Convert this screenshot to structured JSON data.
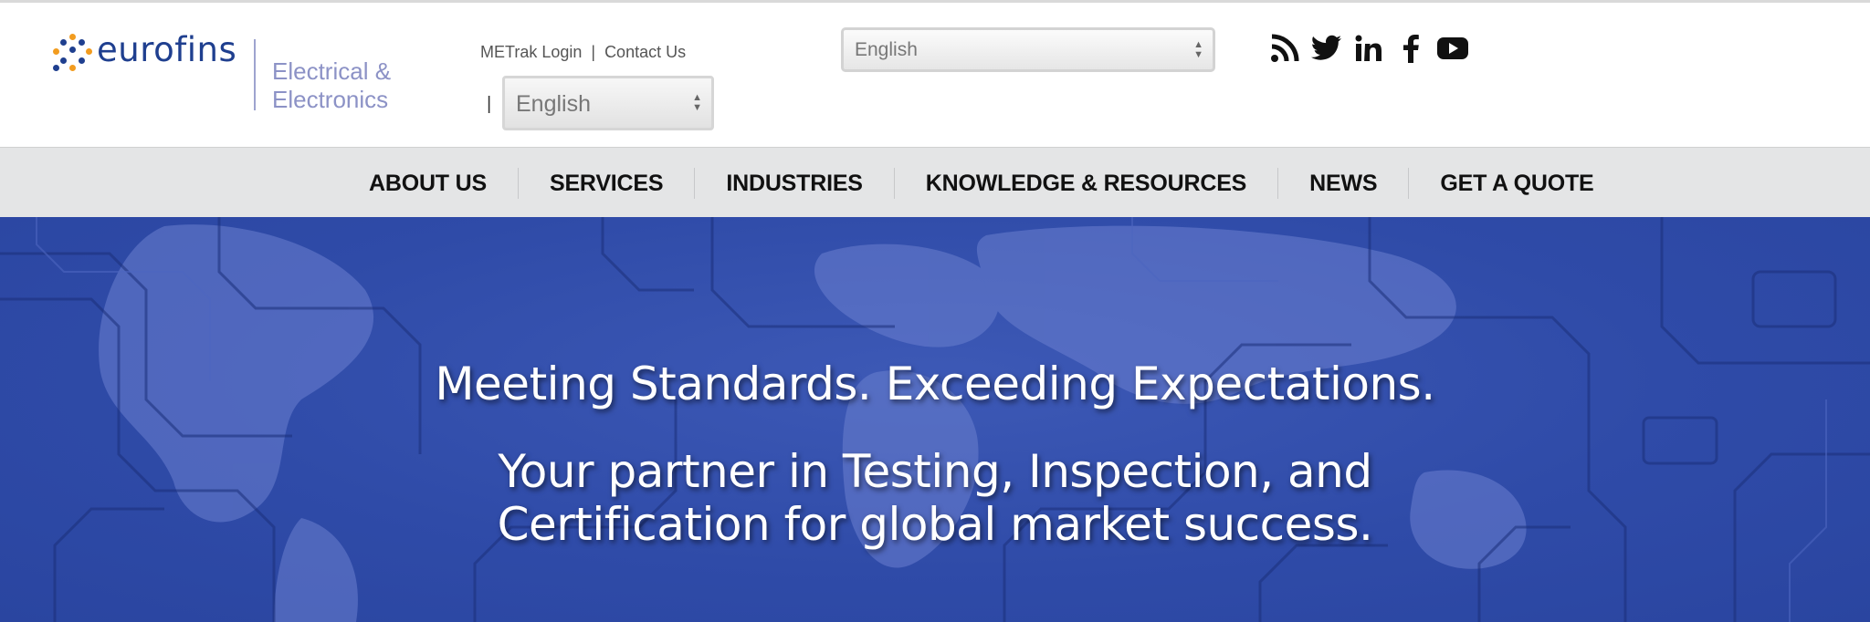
{
  "brand": {
    "wordmark": "eurofins",
    "division_line1": "Electrical &",
    "division_line2": "Electronics"
  },
  "toplinks": {
    "metrak": "METrak Login",
    "separator": "|",
    "contact": "Contact Us"
  },
  "language_small": {
    "selected": "English",
    "separator": "|"
  },
  "language_large": {
    "selected": "English"
  },
  "social": [
    "rss-icon",
    "twitter-icon",
    "linkedin-icon",
    "facebook-icon",
    "youtube-icon"
  ],
  "nav": {
    "items": [
      "ABOUT US",
      "SERVICES",
      "INDUSTRIES",
      "KNOWLEDGE & RESOURCES",
      "NEWS",
      "GET A QUOTE"
    ]
  },
  "hero": {
    "headline": "Meeting Standards. Exceeding Expectations.",
    "tagline_line1": "Your partner in Testing, Inspection, and",
    "tagline_line2": "Certification for global market success."
  },
  "colors": {
    "brand_blue": "#1f3f8f",
    "division_text": "#8c92c6",
    "nav_bg": "#e4e5e6",
    "hero_bg": "#2f4ba8"
  }
}
